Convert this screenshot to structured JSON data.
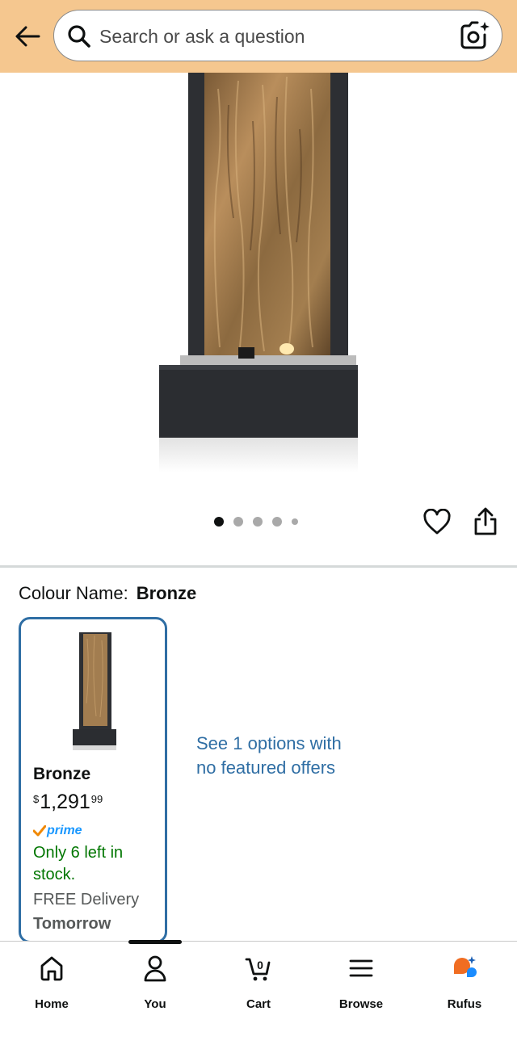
{
  "header": {
    "search_placeholder": "Search or ask a question",
    "background_color": "#f5c78f",
    "back_icon": "arrow-left-icon",
    "search_icon": "search-icon",
    "camera_icon": "camera-sparkle-icon"
  },
  "gallery": {
    "image_count": 5,
    "active_index": 0,
    "wishlist_icon": "heart-icon",
    "share_icon": "share-icon"
  },
  "variation": {
    "label": "Colour Name:",
    "selected_value": "Bronze"
  },
  "variant_card": {
    "name": "Bronze",
    "price_symbol": "$",
    "price_whole": "1,291",
    "price_fraction": "99",
    "prime_label": "prime",
    "stock_text": "Only 6 left in stock.",
    "delivery_text": "FREE Delivery",
    "delivery_day": "Tomorrow",
    "border_color": "#2f6ea4"
  },
  "see_options_link": "See 1 options with no featured offers",
  "bottom_nav": {
    "items": [
      {
        "label": "Home",
        "icon": "home-icon"
      },
      {
        "label": "You",
        "icon": "user-icon"
      },
      {
        "label": "Cart",
        "icon": "cart-icon",
        "badge": "0"
      },
      {
        "label": "Browse",
        "icon": "menu-icon"
      },
      {
        "label": "Rufus",
        "icon": "rufus-icon"
      }
    ],
    "active_index": 1
  }
}
